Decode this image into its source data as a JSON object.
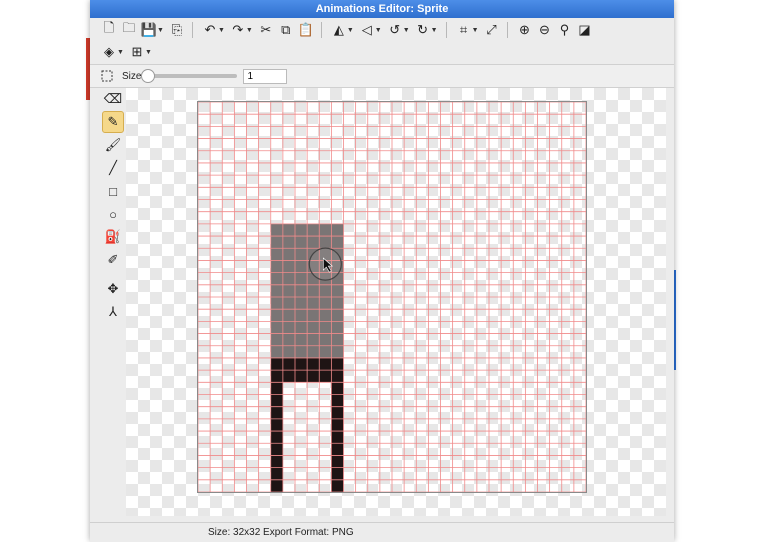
{
  "window": {
    "title": "Animations Editor: Sprite"
  },
  "toolbar": {
    "row1": [
      {
        "name": "new-file-icon",
        "glyph": "🗋"
      },
      {
        "name": "open-folder-icon",
        "glyph": "🗀"
      },
      {
        "name": "save-icon",
        "glyph": "💾",
        "caret": true
      },
      {
        "name": "export-icon",
        "glyph": "⎘"
      },
      {
        "sep": true
      },
      {
        "name": "undo-icon",
        "glyph": "↶",
        "caret": true
      },
      {
        "name": "redo-icon",
        "glyph": "↷",
        "caret": true
      },
      {
        "name": "cut-icon",
        "glyph": "✂"
      },
      {
        "name": "copy-icon",
        "glyph": "⧉"
      },
      {
        "name": "paste-icon",
        "glyph": "📋"
      },
      {
        "sep": true
      },
      {
        "name": "flip-horizontal-icon",
        "glyph": "◭",
        "caret": true
      },
      {
        "name": "flip-vertical-icon",
        "glyph": "◁",
        "caret": true
      },
      {
        "name": "rotate-left-icon",
        "glyph": "↺",
        "caret": true
      },
      {
        "name": "rotate-right-icon",
        "glyph": "↻",
        "caret": true
      },
      {
        "sep": true
      },
      {
        "name": "crop-icon",
        "glyph": "⌗",
        "caret": true
      },
      {
        "name": "resize-icon",
        "glyph": "⤢"
      },
      {
        "sep": true
      },
      {
        "name": "zoom-in-icon",
        "glyph": "⊕"
      },
      {
        "name": "zoom-out-icon",
        "glyph": "⊖"
      },
      {
        "name": "zoom-fit-icon",
        "glyph": "⚲"
      },
      {
        "name": "background-toggle-icon",
        "glyph": "◪"
      }
    ],
    "row2": [
      {
        "name": "layers-icon",
        "glyph": "◈",
        "caret": true
      },
      {
        "name": "grid-icon",
        "glyph": "⊞",
        "caret": true
      }
    ]
  },
  "options": {
    "selection_icon": "selection-rect-icon",
    "size_label": "Size",
    "size_value": "1",
    "size_slider_fraction": 0.0
  },
  "tools": [
    {
      "name": "eraser-tool",
      "glyph": "⌫"
    },
    {
      "name": "pencil-tool",
      "glyph": "✎",
      "active": true
    },
    {
      "name": "brush-tool",
      "glyph": "🖌"
    },
    {
      "name": "line-tool",
      "glyph": "╱"
    },
    {
      "name": "rectangle-tool",
      "glyph": "□"
    },
    {
      "name": "ellipse-tool",
      "glyph": "○"
    },
    {
      "name": "fill-bucket-tool",
      "glyph": "⛽"
    },
    {
      "name": "eyedropper-tool",
      "glyph": "✐"
    },
    {
      "sep": true
    },
    {
      "name": "move-pixels-tool",
      "glyph": "✥"
    },
    {
      "name": "transform-tool",
      "glyph": "⅄"
    }
  ],
  "sprite": {
    "grid_cols": 32,
    "grid_rows": 32,
    "grid_color": "#f08a8a",
    "gray_color": "#7a7575",
    "dark_color": "#1e1414",
    "blocks": [
      {
        "color": "gray",
        "col": 6,
        "row": 10,
        "w": 6,
        "h": 11
      },
      {
        "color": "dark",
        "col": 6,
        "row": 21,
        "w": 6,
        "h": 2
      },
      {
        "color": "dark",
        "col": 6,
        "row": 23,
        "w": 1,
        "h": 9
      },
      {
        "color": "dark",
        "col": 11,
        "row": 23,
        "w": 1,
        "h": 9
      }
    ],
    "cursor_cell": {
      "col": 10.5,
      "row": 13.3
    }
  },
  "status": {
    "text": "Size: 32x32   Export Format: PNG"
  }
}
